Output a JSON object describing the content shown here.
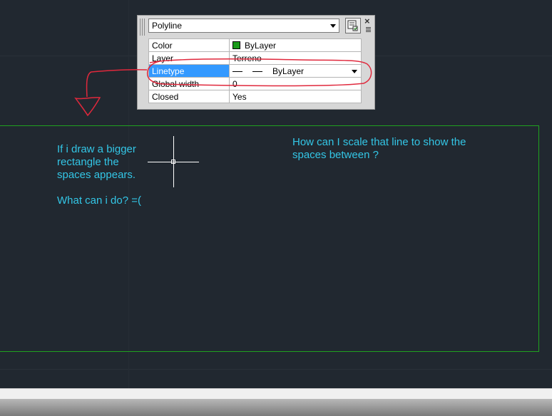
{
  "palette": {
    "object_type": "Polyline",
    "close_glyph": "×",
    "properties": [
      {
        "name": "Color",
        "value": "ByLayer",
        "swatch_color": "#1a9a1a"
      },
      {
        "name": "Layer",
        "value": "Terreno"
      },
      {
        "name": "Linetype",
        "value": "ByLayer",
        "selected": true
      },
      {
        "name": "Global width",
        "value": "0"
      },
      {
        "name": "Closed",
        "value": "Yes"
      }
    ]
  },
  "notes": {
    "left": "If i draw a bigger\nrectangle the\nspaces appears.\n\nWhat can i do? =(",
    "right": "How can I scale that line to show the\nspaces between  ?"
  },
  "colors": {
    "canvas_bg": "#212830",
    "note_text": "#33c6e6",
    "rectangle_line": "#1fa21f",
    "selection": "#3399ff",
    "annotation": "#e0283c"
  },
  "icons": {
    "quick_select": "quick-select-icon",
    "close": "close-icon",
    "palette_menu": "palette-menu-icon"
  }
}
